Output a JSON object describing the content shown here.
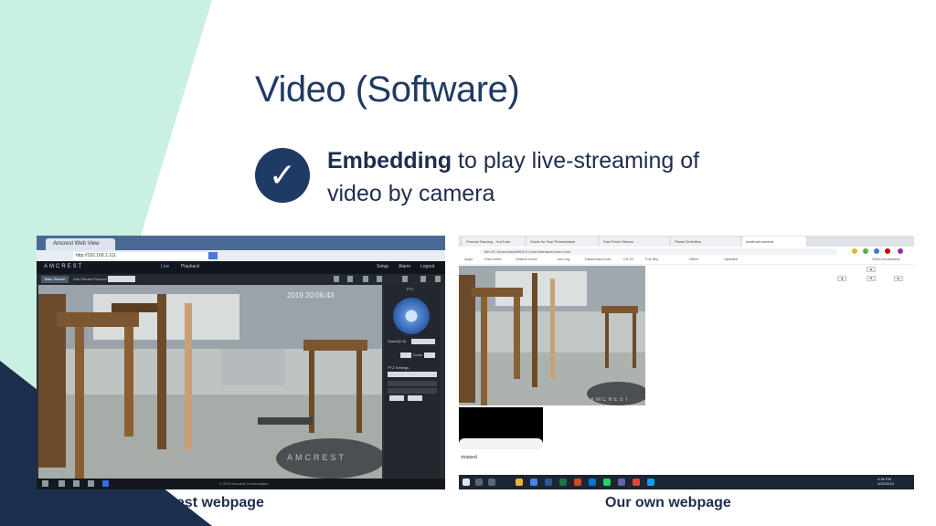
{
  "slide": {
    "title": "Video (Software)",
    "bullet_bold": "Embedding",
    "bullet_rest": " to play live-streaming of video by camera",
    "check_glyph": "✓"
  },
  "colors": {
    "mint_triangle": "#c9f0e1",
    "navy_triangle": "#1d2f4f",
    "title": "#1f3a64",
    "accent": "#1f3a64"
  },
  "amcrest_shot": {
    "window_tab": "Amcrest Web View",
    "url": "http://192.168.1.111",
    "logo": "AMCREST",
    "nav_live": "Live",
    "nav_playback": "Playback",
    "header_right": [
      "Setup",
      "Alarm",
      "Logout"
    ],
    "toolbar_button": "Main Stream",
    "toolbar_sub": "Sub Stream",
    "toolbar_protocol": "Protocol",
    "ptz_title": "PTZ",
    "ptz_speed": "Speed(1-8)",
    "ptz_zoom": "Zoom",
    "ptz_settings": "PTZ Settings",
    "ptz_preset": "Preset",
    "video_timestamp": "2019 20:06:43",
    "video_watermark": "AMCREST",
    "copyright": "© 2019 Amcrest Technologies"
  },
  "own_shot": {
    "tabs": [
      "Product Gaming - YouTube",
      "Guide for Your Presentation",
      "Fast Fetch Stream",
      "Planet Definition",
      "localhost:camera"
    ],
    "url": "file:///C:/Downloads/MHC2/Code/Interface/Index.html",
    "bookmarks": [
      "Apps",
      "Fast notes",
      "Shared notes",
      "cnn.org",
      "Dashboard.com",
      "CS 2C",
      "Full Sky",
      "Office",
      "Updates",
      "Other bookmarks"
    ],
    "video_watermark": "AMCREST",
    "stopped_label": "stopped",
    "ctrl_arrows": [
      "◂",
      "▴",
      "▾",
      "▸"
    ],
    "clock_time": "4:36 PM",
    "clock_date": "4/22/2019"
  },
  "captions": {
    "left": "Amcrest webpage",
    "right": "Our own webpage"
  }
}
